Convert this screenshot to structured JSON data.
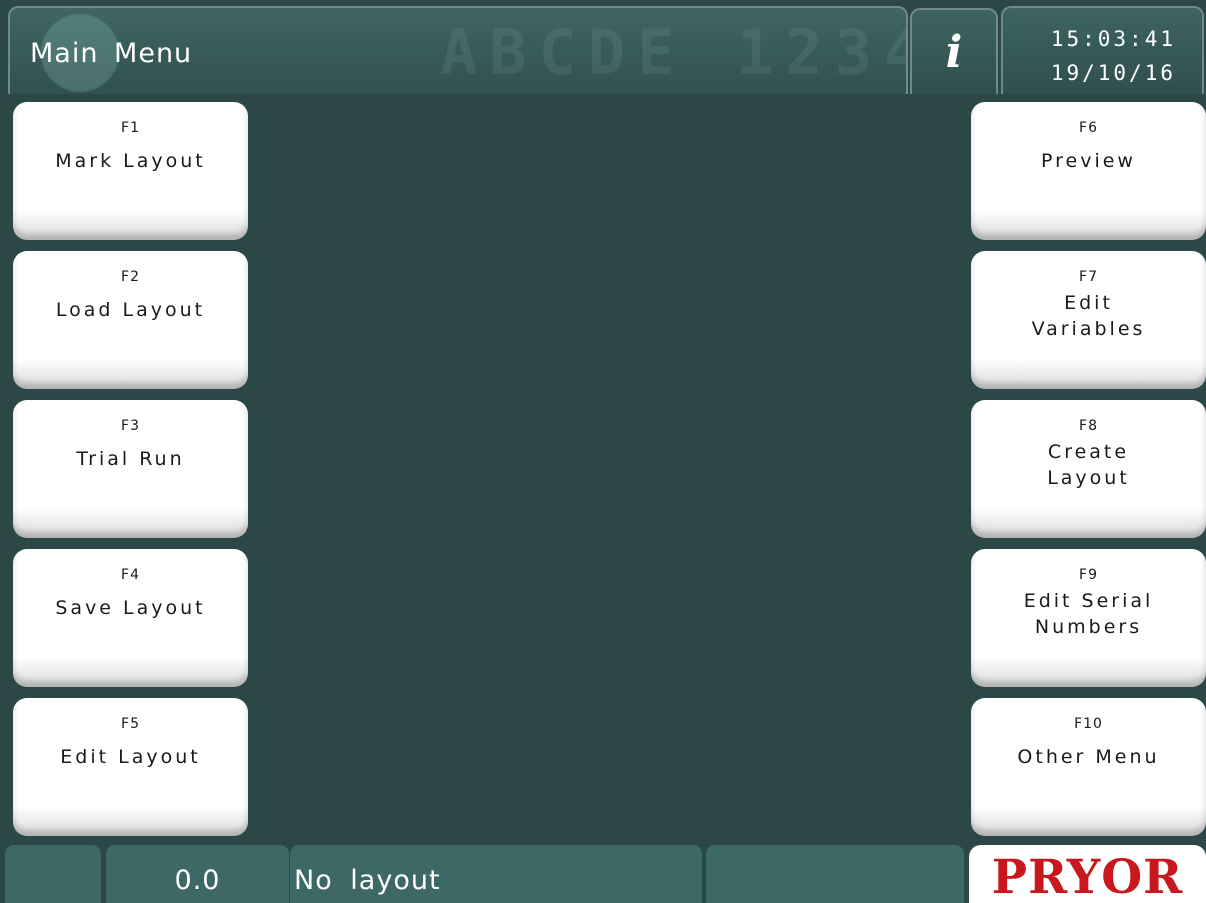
{
  "header": {
    "title": "Main Menu",
    "info_glyph": "i",
    "time": "15:03:41",
    "date": "19/10/16"
  },
  "left_keys": [
    {
      "key": "F1",
      "label": "Mark Layout"
    },
    {
      "key": "F2",
      "label": "Load Layout"
    },
    {
      "key": "F3",
      "label": "Trial Run"
    },
    {
      "key": "F4",
      "label": "Save Layout"
    },
    {
      "key": "F5",
      "label": "Edit Layout"
    }
  ],
  "right_keys": [
    {
      "key": "F6",
      "label": "Preview"
    },
    {
      "key": "F7",
      "label": "Edit\nVariables"
    },
    {
      "key": "F8",
      "label": "Create\nLayout"
    },
    {
      "key": "F9",
      "label": "Edit Serial\nNumbers"
    },
    {
      "key": "F10",
      "label": "Other Menu"
    }
  ],
  "status": {
    "value": "0.0",
    "layout": "No layout",
    "brand": "PRYOR"
  },
  "colors": {
    "background": "#2b4847",
    "status_segment": "#3d6866",
    "brand_red": "#c8181e"
  }
}
